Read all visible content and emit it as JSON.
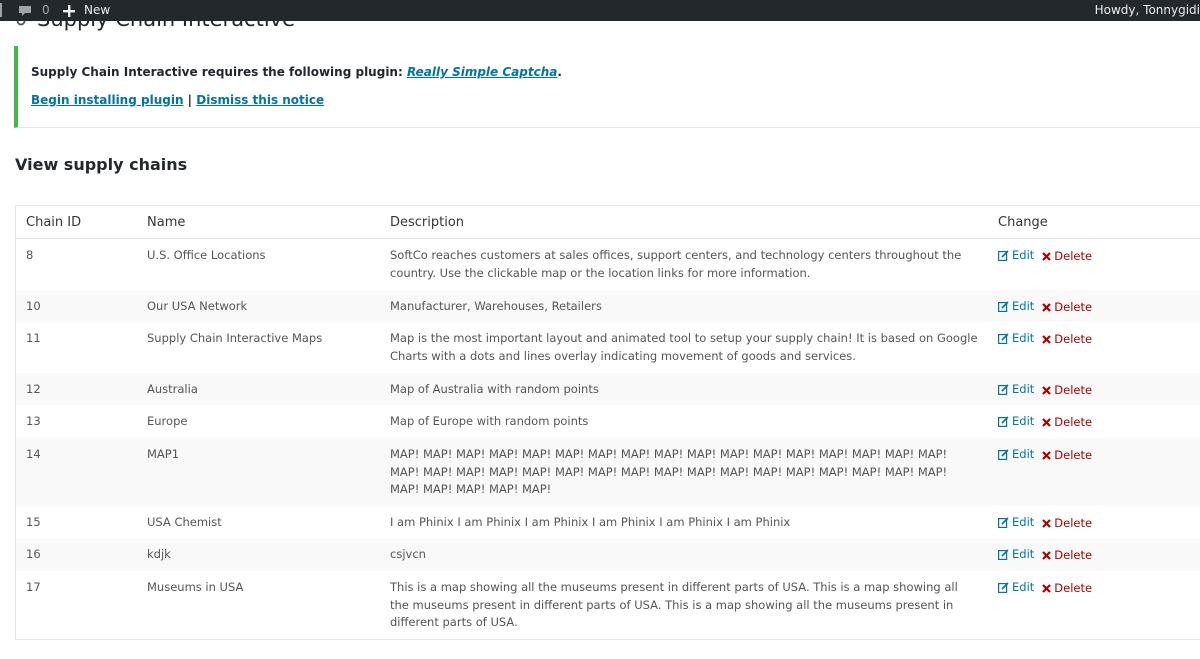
{
  "adminbar": {
    "comment_count": "0",
    "new_label": "New",
    "howdy": "Howdy, Tonnygidi"
  },
  "page_title": "Supply Chain Interactive",
  "notice": {
    "message_prefix": "Supply Chain Interactive requires the following plugin:",
    "plugin_link": "Really Simple Captcha",
    "message_suffix": ".",
    "begin_install": "Begin installing plugin",
    "separator": "|",
    "dismiss": "Dismiss this notice",
    "border_color": "#46b450"
  },
  "section_heading": "View supply chains",
  "table": {
    "headers": {
      "id": "Chain ID",
      "name": "Name",
      "description": "Description",
      "change": "Change"
    },
    "edit_label": "Edit",
    "delete_label": "Delete",
    "rows": [
      {
        "id": "8",
        "name": "U.S. Office Locations",
        "description": "SoftCo reaches customers at sales offices, support centers, and technology centers throughout the country. Use the clickable map or the location links for more information."
      },
      {
        "id": "10",
        "name": "Our USA Network",
        "description": "Manufacturer, Warehouses, Retailers"
      },
      {
        "id": "11",
        "name": "Supply Chain Interactive Maps",
        "description": "Map is the most important layout and animated tool to setup your supply chain! It is based on Google Charts with a dots and lines overlay indicating movement of goods and services."
      },
      {
        "id": "12",
        "name": "Australia",
        "description": "Map of Australia with random points"
      },
      {
        "id": "13",
        "name": "Europe",
        "description": "Map of Europe with random points"
      },
      {
        "id": "14",
        "name": "MAP1",
        "description": "MAP! MAP! MAP! MAP! MAP! MAP! MAP! MAP! MAP! MAP! MAP! MAP! MAP! MAP! MAP! MAP! MAP! MAP! MAP! MAP! MAP! MAP! MAP! MAP! MAP! MAP! MAP! MAP! MAP! MAP! MAP! MAP! MAP! MAP! MAP! MAP! MAP! MAP! MAP!"
      },
      {
        "id": "15",
        "name": "USA Chemist",
        "description": "I am Phinix I am Phinix I am Phinix I am Phinix I am Phinix I am Phinix"
      },
      {
        "id": "16",
        "name": "kdjk",
        "description": "csjvcn"
      },
      {
        "id": "17",
        "name": "Museums in USA",
        "description": "This is a map showing all the museums present in different parts of USA. This is a map showing all the museums present in different parts of USA. This is a map showing all the museums present in different parts of USA."
      }
    ]
  }
}
